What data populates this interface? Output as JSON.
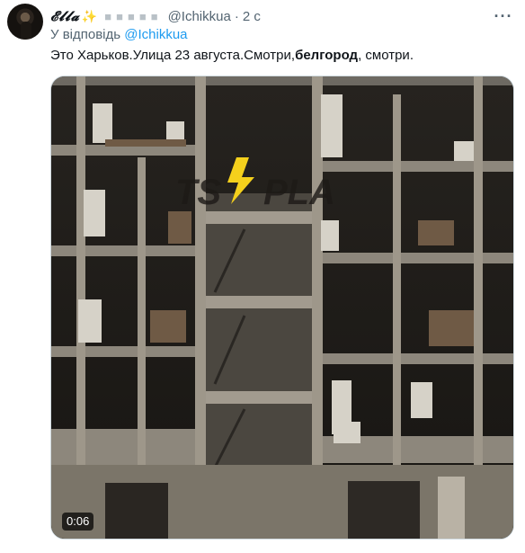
{
  "author": {
    "display_name": "𝓔𝓵𝓵𝓪",
    "badge_emoji": "✨",
    "handle": "@Ichikkua",
    "separator": "·",
    "time": "2 с",
    "more_icon": "more-horizontal-icon"
  },
  "reply": {
    "prefix": "У відповідь",
    "mention": "@Ichikkua"
  },
  "tweet": {
    "text_1": "Это Харьков.Улица 23 августа.Смотри,",
    "text_bold": "белгород",
    "text_2": ", смотри."
  },
  "media": {
    "type": "video",
    "duration": "0:06",
    "watermark_logo": "TSAPLA",
    "watermark_color": "#f4d01c"
  }
}
